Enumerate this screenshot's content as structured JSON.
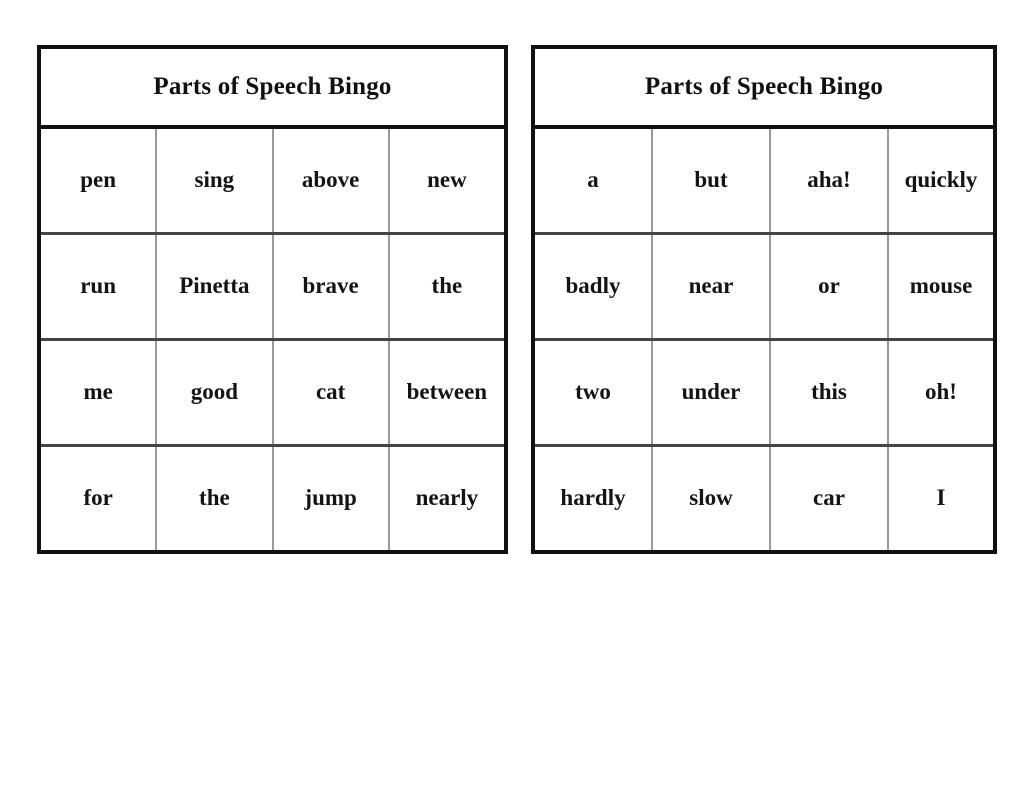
{
  "page": {
    "background_color": "#ffffff",
    "border_color": "#101010",
    "grid_line_color": "#9a9a9a",
    "row_line_color": "#444444",
    "text_color": "#141414"
  },
  "cards": [
    {
      "id": "left",
      "title": "Parts of Speech Bingo",
      "rows": [
        [
          "pen",
          "sing",
          "above",
          "new"
        ],
        [
          "run",
          "Pinetta",
          "brave",
          "the"
        ],
        [
          "me",
          "good",
          "cat",
          "between"
        ],
        [
          "for",
          "the",
          "jump",
          "nearly"
        ]
      ]
    },
    {
      "id": "right",
      "title": "Parts of Speech Bingo",
      "rows": [
        [
          "a",
          "but",
          "aha!",
          "quickly"
        ],
        [
          "badly",
          "near",
          "or",
          "mouse"
        ],
        [
          "two",
          "under",
          "this",
          "oh!"
        ],
        [
          "hardly",
          "slow",
          "car",
          "I"
        ]
      ]
    }
  ]
}
